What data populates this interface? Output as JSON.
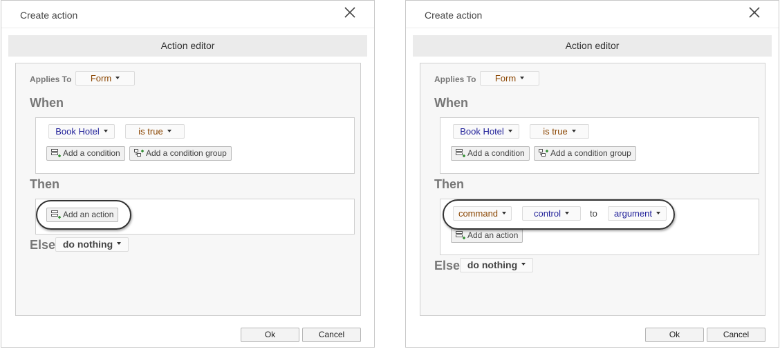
{
  "dialogs": [
    {
      "title": "Create action",
      "editor_header": "Action editor",
      "applies_to": {
        "label": "Applies To",
        "value": "Form"
      },
      "when": {
        "heading": "When",
        "field": "Book Hotel",
        "operator": "is true",
        "add_condition": "Add a condition",
        "add_condition_group": "Add a condition group"
      },
      "then": {
        "heading": "Then",
        "add_action": "Add an action"
      },
      "else": {
        "heading": "Else",
        "value": "do nothing"
      },
      "buttons": {
        "ok": "Ok",
        "cancel": "Cancel"
      }
    },
    {
      "title": "Create action",
      "editor_header": "Action editor",
      "applies_to": {
        "label": "Applies To",
        "value": "Form"
      },
      "when": {
        "heading": "When",
        "field": "Book Hotel",
        "operator": "is true",
        "add_condition": "Add a condition",
        "add_condition_group": "Add a condition group"
      },
      "then": {
        "heading": "Then",
        "command": "command",
        "control": "control",
        "to": "to",
        "argument": "argument",
        "add_action": "Add an action"
      },
      "else": {
        "heading": "Else",
        "value": "do nothing"
      },
      "buttons": {
        "ok": "Ok",
        "cancel": "Cancel"
      }
    }
  ],
  "icons": {
    "close": "close-icon",
    "add_condition": "add-condition-icon",
    "add_condition_group": "add-condition-group-icon",
    "add_action": "add-action-icon"
  }
}
